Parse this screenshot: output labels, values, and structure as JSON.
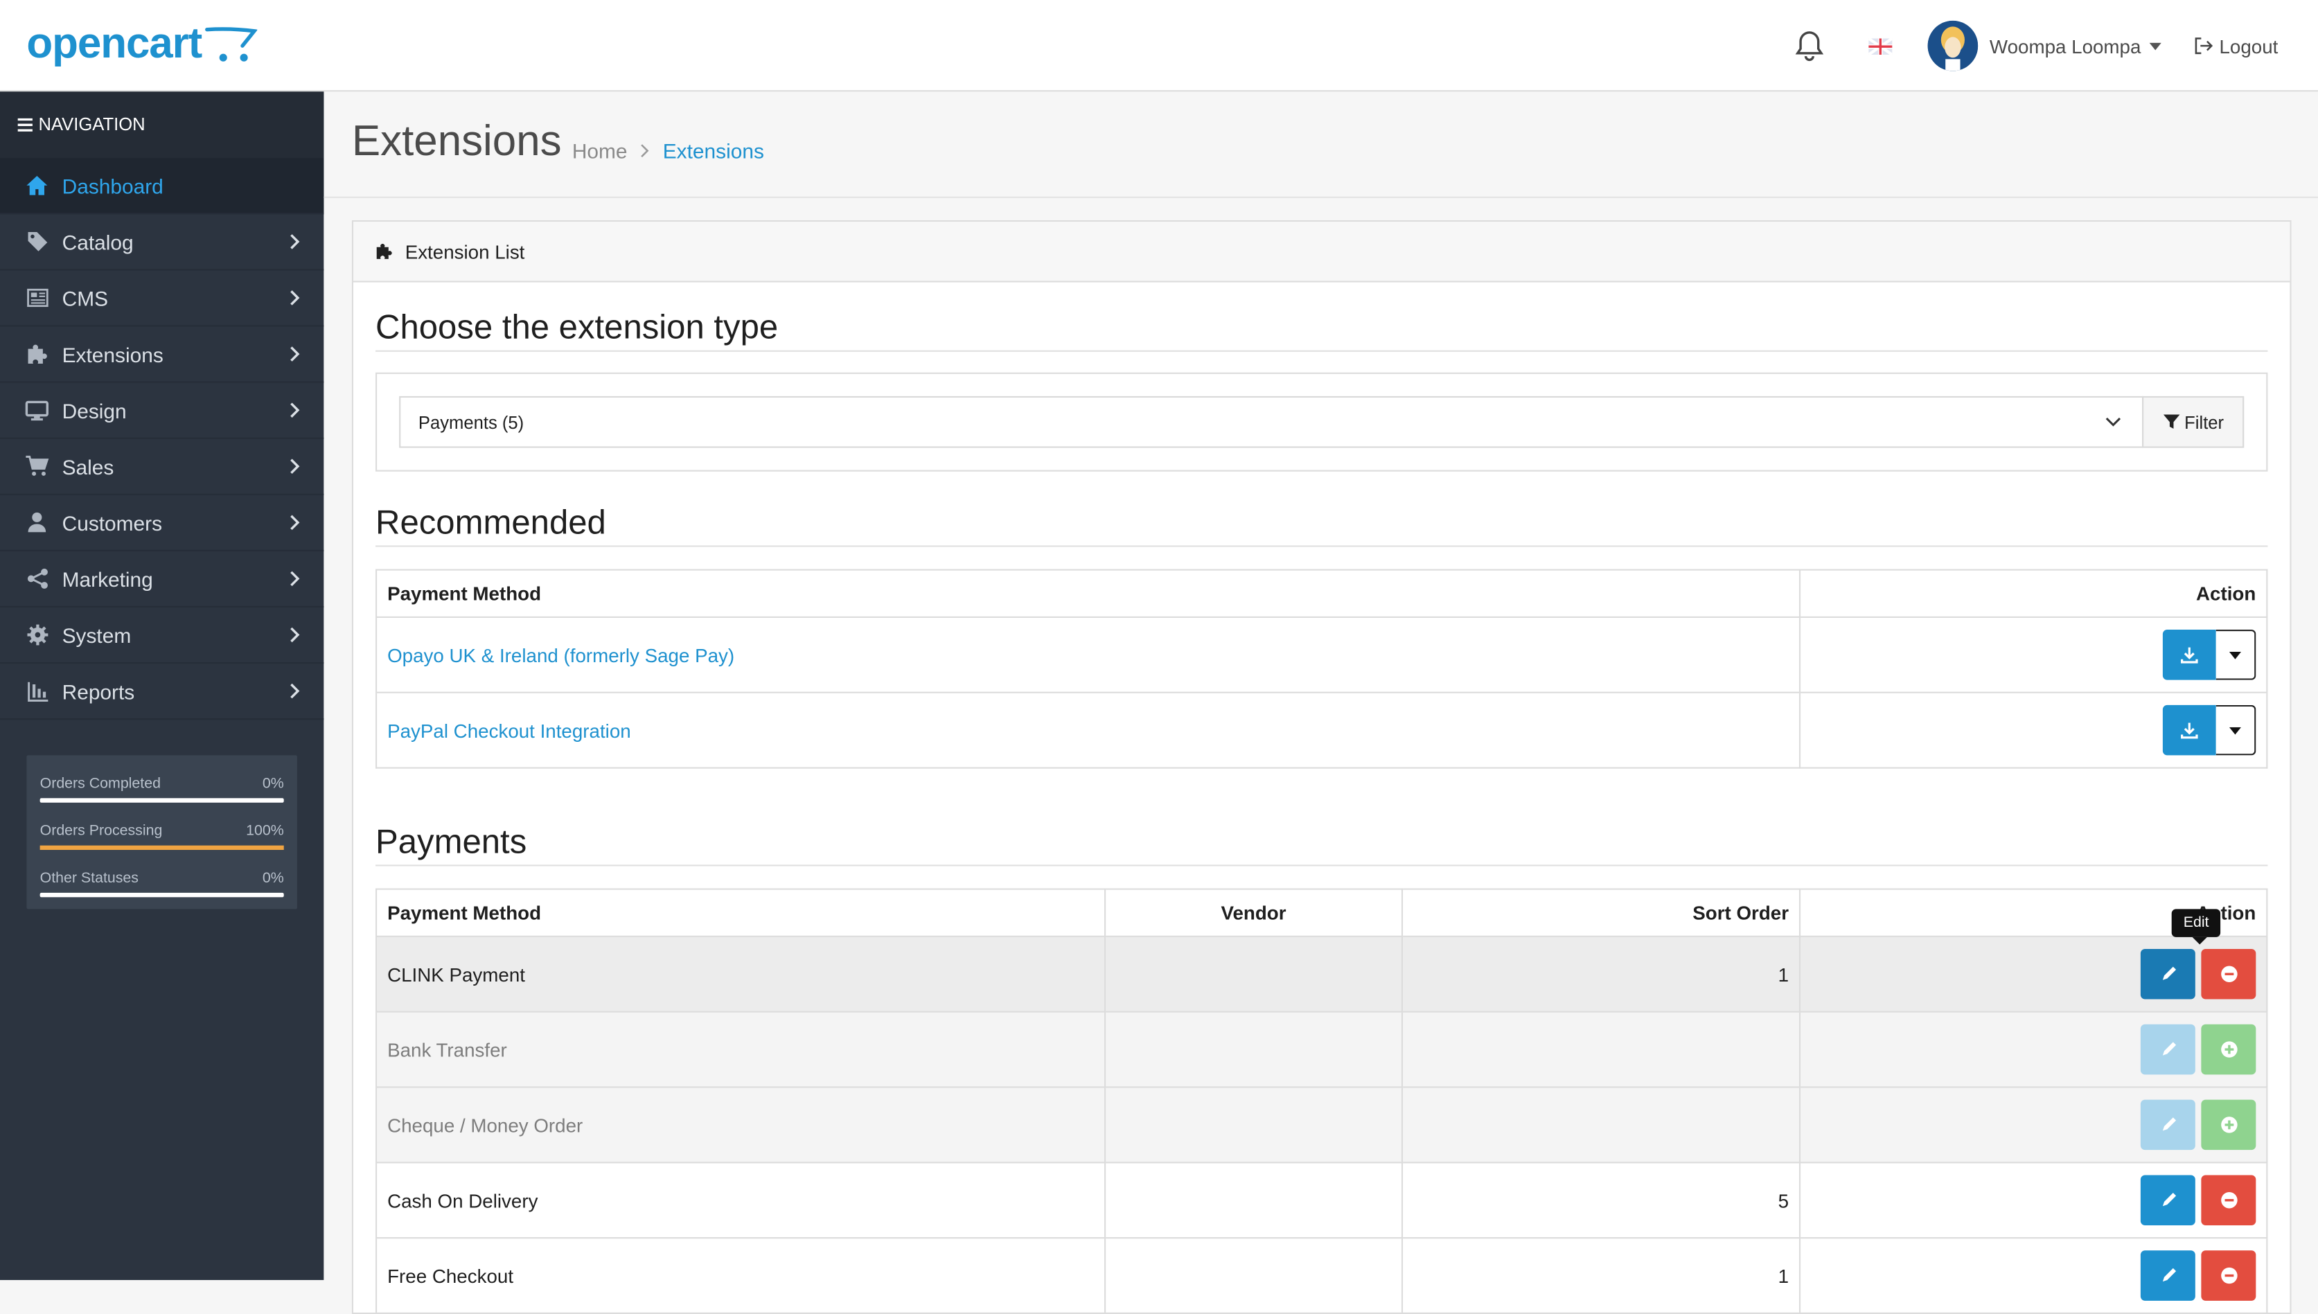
{
  "header": {
    "logo_text": "opencart",
    "user_name": "Woompa Loompa",
    "logout_label": "Logout"
  },
  "sidebar": {
    "title": "NAVIGATION",
    "items": [
      {
        "label": "Dashboard",
        "icon": "home-icon"
      },
      {
        "label": "Catalog",
        "icon": "tag-icon"
      },
      {
        "label": "CMS",
        "icon": "newspaper-icon"
      },
      {
        "label": "Extensions",
        "icon": "puzzle-icon"
      },
      {
        "label": "Design",
        "icon": "monitor-icon"
      },
      {
        "label": "Sales",
        "icon": "cart-icon"
      },
      {
        "label": "Customers",
        "icon": "user-icon"
      },
      {
        "label": "Marketing",
        "icon": "share-icon"
      },
      {
        "label": "System",
        "icon": "gear-icon"
      },
      {
        "label": "Reports",
        "icon": "bar-chart-icon"
      }
    ],
    "stats": [
      {
        "label": "Orders Completed",
        "value": "0%",
        "fraction": 0
      },
      {
        "label": "Orders Processing",
        "value": "100%",
        "fraction": 1
      },
      {
        "label": "Other Statuses",
        "value": "0%",
        "fraction": 0
      }
    ]
  },
  "page": {
    "title": "Extensions",
    "breadcrumb": [
      "Home",
      "Extensions"
    ]
  },
  "card": {
    "header": "Extension List",
    "choose_title": "Choose the extension type",
    "select_value": "Payments (5)",
    "filter_label": "Filter",
    "recommended_title": "Recommended",
    "recommended_headers": [
      "Payment Method",
      "Action"
    ],
    "recommended": [
      "Opayo UK & Ireland (formerly Sage Pay)",
      "PayPal Checkout Integration"
    ],
    "payments_title": "Payments",
    "payments_headers": [
      "Payment Method",
      "Vendor",
      "Sort Order",
      "Action"
    ],
    "payments": [
      {
        "name": "CLINK Payment",
        "vendor": "",
        "sort": "1",
        "installed": true
      },
      {
        "name": "Bank Transfer",
        "vendor": "",
        "sort": "",
        "installed": false
      },
      {
        "name": "Cheque / Money Order",
        "vendor": "",
        "sort": "",
        "installed": false
      },
      {
        "name": "Cash On Delivery",
        "vendor": "",
        "sort": "5",
        "installed": true
      },
      {
        "name": "Free Checkout",
        "vendor": "",
        "sort": "1",
        "installed": true
      }
    ],
    "tooltip": "Edit"
  },
  "colors": {
    "accent": "#1e91cf",
    "sidebar_bg": "#2c3440",
    "danger": "#e34d3f",
    "success_light": "#8fd38f"
  }
}
